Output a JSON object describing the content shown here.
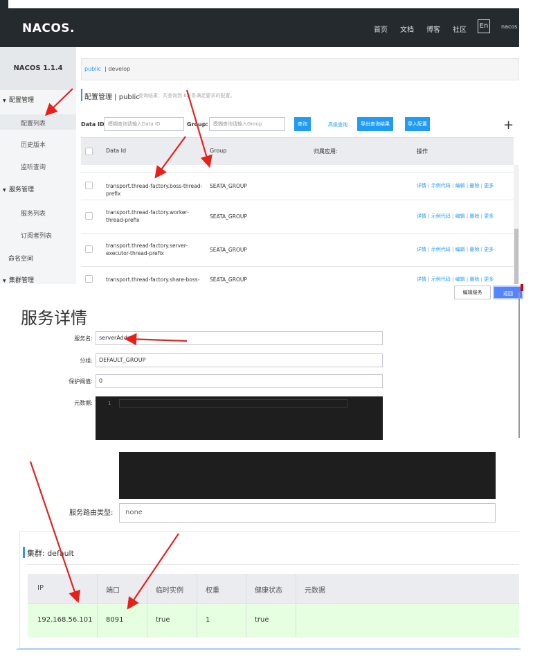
{
  "config_page": {
    "logo": "NACOS.",
    "topnav": [
      "首页",
      "文档",
      "博客",
      "社区"
    ],
    "lang_button": "En",
    "user": "nacos",
    "version": "NACOS 1.1.4",
    "sidebar": {
      "config_group": "配置管理",
      "config_list": "配置列表",
      "history": "历史版本",
      "listen_query": "监听查询",
      "service_group": "服务管理",
      "service_list": "服务列表",
      "subscriber_list": "订阅者列表",
      "namespace": "命名空间",
      "cluster_group": "集群管理"
    },
    "breadcrumb": {
      "ns_public": "public",
      "ns_develop": "| develop"
    },
    "title": "配置管理 | public",
    "subtitle": "查询结果：共查询到 62 条满足要求的配置。",
    "search": {
      "data_id_label": "Data ID:",
      "data_id_placeholder": "模糊查询请输入Data ID",
      "group_label": "Group:",
      "group_placeholder": "模糊查询请输入Group",
      "query_button": "查询",
      "advanced_link": "高级查询",
      "export_button": "导出查询结果",
      "import_button": "导入配置",
      "add_button": "+"
    },
    "table": {
      "headers": [
        "Data Id",
        "Group",
        "归属应用:",
        "操作"
      ],
      "rows": [
        {
          "data_id": "transport.thread-factory.boss-thread-prefix",
          "group": "SEATA_GROUP"
        },
        {
          "data_id": "transport.thread-factory.worker-thread-prefix",
          "group": "SEATA_GROUP"
        },
        {
          "data_id": "transport.thread-factory.server-executor-thread-prefix",
          "group": "SEATA_GROUP"
        },
        {
          "data_id": "transport.thread-factory.share-boss-worker",
          "group": "SEATA_GROUP"
        }
      ],
      "ops": [
        "详情",
        "示例代码",
        "编辑",
        "删除",
        "更多"
      ]
    }
  },
  "service_detail": {
    "title": "服务详情",
    "edit_button": "编辑服务",
    "back_button": "返回",
    "fields": {
      "name_label": "服务名:",
      "name_value": "serverAddr",
      "group_label": "分组:",
      "group_value": "DEFAULT_GROUP",
      "threshold_label": "保护阈值:",
      "threshold_value": "0",
      "metadata_label": "元数据:",
      "metadata_line": "1"
    }
  },
  "cluster": {
    "route_label": "服务路由类型:",
    "route_value": "none",
    "title": "集群: default",
    "headers": [
      "IP",
      "端口",
      "临时实例",
      "权重",
      "健康状态",
      "元数据"
    ],
    "instance": {
      "ip": "192.168.56.101",
      "port": "8091",
      "ephemeral": "true",
      "weight": "1",
      "healthy": "true",
      "metadata": ""
    }
  },
  "colors": {
    "primary": "#209bfa",
    "topbar": "#252a2f",
    "annotation_arrow": "#e8201a",
    "healthy_row": "#e6ffe0"
  }
}
